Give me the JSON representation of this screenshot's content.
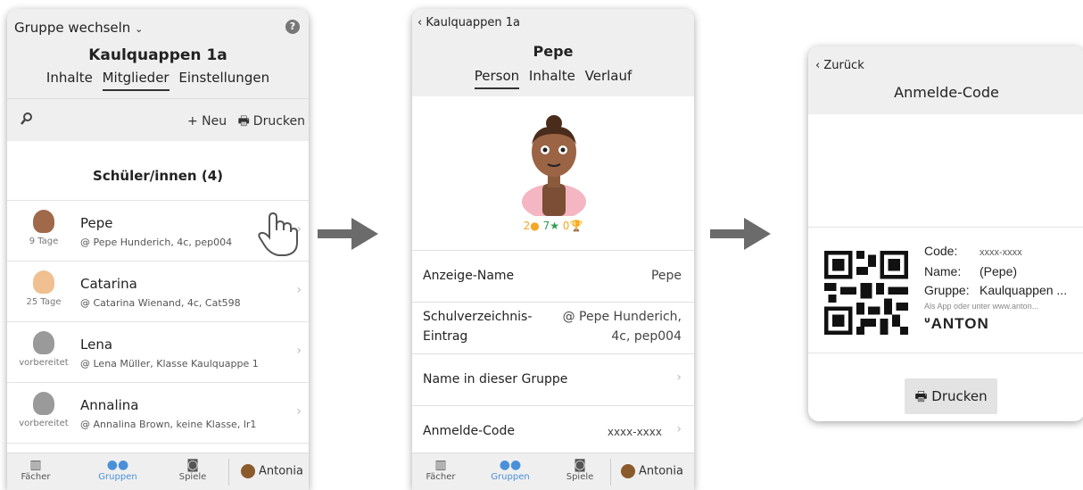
{
  "screen1": {
    "group_switch": "Gruppe wechseln",
    "help": "?",
    "group_title": "Kaulquappen 1a",
    "tabs": [
      "Inhalte",
      "Mitglieder",
      "Einstellungen"
    ],
    "new_label": "+ Neu",
    "print_label": "Drucken",
    "section_title": "Schüler/innen (4)",
    "students": [
      {
        "name": "Pepe",
        "sub": "9 Tage",
        "handle": "@ Pepe Hunderich, 4c, pep004"
      },
      {
        "name": "Catarina",
        "sub": "25 Tage",
        "handle": "@ Catarina Wienand, 4c, Cat598"
      },
      {
        "name": "Lena",
        "sub": "vorbereitet",
        "handle": "@ Lena Müller, Klasse Kaulquappe 1"
      },
      {
        "name": "Annalina",
        "sub": "vorbereitet",
        "handle": "@ Annalina Brown, keine Klasse, lr1"
      }
    ]
  },
  "bottom_nav": {
    "items": [
      "Fächer",
      "Gruppen",
      "Spiele"
    ],
    "user": "Antonia"
  },
  "screen2": {
    "back": "‹ Kaulquappen 1a",
    "name": "Pepe",
    "tabs": [
      "Person",
      "Inhalte",
      "Verlauf"
    ],
    "stats": {
      "coins": "2",
      "stars": "7",
      "trophies": "0"
    },
    "rows": [
      {
        "label": "Anzeige-Name",
        "value": "Pepe"
      },
      {
        "label1": "Schulverzeichnis-",
        "label2": "Eintrag",
        "value1": "@ Pepe Hunderich,",
        "value2": "4c, pep004"
      },
      {
        "label": "Name in dieser Gruppe"
      },
      {
        "label": "Anmelde-Code",
        "value": "xxxx-xxxx"
      }
    ]
  },
  "screen3": {
    "back": "‹ Zurück",
    "title": "Anmelde-Code",
    "code_label": "Code:",
    "code_value": "xxxx-xxxx",
    "name_label": "Name:",
    "name_value": "(Pepe)",
    "group_label": "Gruppe:",
    "group_value": "Kaulquappen ...",
    "hint": "Als App oder unter www.anton...",
    "logo": "ANTON",
    "print": "Drucken"
  },
  "colors": {
    "active_nav": "#4a90d9",
    "arrow": "#6b6b6b",
    "coin": "#f5a623",
    "star": "#2e9e4f"
  }
}
